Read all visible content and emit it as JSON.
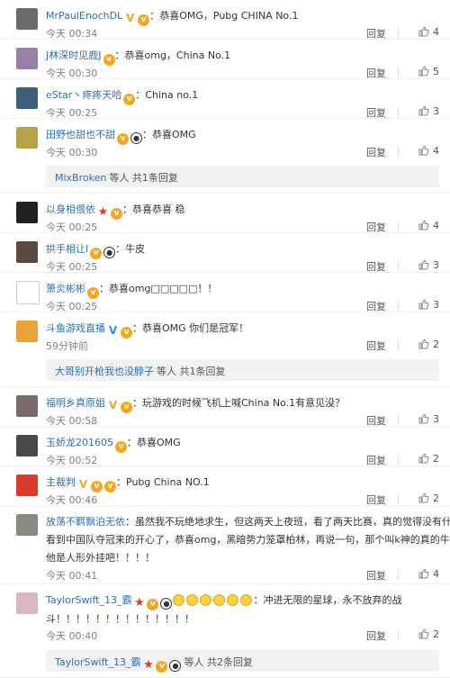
{
  "comments": [
    {
      "user": "MrPaulEnochDL",
      "badges": [
        "vbadge",
        "vip"
      ],
      "sep": "：",
      "text": "恭喜OMG，Pubg CHINA No.1",
      "time": "今天 00:34",
      "reply": "回复",
      "likes": "4",
      "avatar_color": "#6a6a6a"
    },
    {
      "user": "J林深时见鹿J",
      "badges": [
        "vip"
      ],
      "sep": "：",
      "text": "恭喜omg，China No.1",
      "time": "今天 00:30",
      "reply": "回复",
      "likes": "5",
      "avatar_color": "#9a7fa6"
    },
    {
      "user": "eStar丶疼疼天哈",
      "badges": [
        "vip"
      ],
      "sep": "：",
      "text": "China no.1",
      "time": "今天 00:25",
      "reply": "回复",
      "likes": "3",
      "avatar_color": "#3d5f7a"
    },
    {
      "user": "田野也甜也不甜",
      "badges": [
        "vip",
        "panda"
      ],
      "sep": "：",
      "text": "恭喜OMG",
      "time": "今天 00:30",
      "reply": "回复",
      "likes": "4",
      "avatar_color": "#b8a24a"
    },
    {
      "user": "以身相偎依",
      "badges": [
        "star",
        "vip"
      ],
      "sep": "：",
      "text": "恭喜恭喜 稳",
      "time": "今天 00:25",
      "reply": "回复",
      "likes": "4",
      "avatar_color": "#222222"
    },
    {
      "user": "拱手相让l",
      "badges": [
        "vip",
        "panda"
      ],
      "sep": "：",
      "text": "牛皮",
      "time": "今天 00:25",
      "reply": "回复",
      "likes": "3",
      "avatar_color": "#5b4a3f"
    },
    {
      "user": "箫炎彬彬",
      "badges": [
        "vip"
      ],
      "sep": "：",
      "text": "恭喜omg□□□□□！！",
      "time": "今天 00:25",
      "reply": "回复",
      "likes": "3",
      "avatar_color": "#ffffff"
    },
    {
      "user": "斗鱼游戏直播",
      "badges": [
        "vbadge-blue",
        "vip"
      ],
      "sep": "：",
      "text": "恭喜OMG 你们是冠军！",
      "time": "59分钟前",
      "reply": "回复",
      "likes": "2",
      "avatar_color": "#e8a33b"
    },
    {
      "user": "福明乡真原姐",
      "badges": [
        "vbadge",
        "vip"
      ],
      "sep": "：",
      "text": "玩游戏的时候飞机上喊China No.1有意见没？",
      "time": "今天 00:58",
      "reply": "回复",
      "likes": "3",
      "avatar_color": "#7a6a6a"
    },
    {
      "user": "玉娇龙201605",
      "badges": [
        "vip"
      ],
      "sep": "：",
      "text": "恭喜OMG",
      "time": "今天 00:52",
      "reply": "回复",
      "likes": "2",
      "avatar_color": "#4a4a4a"
    },
    {
      "user": "主裁判",
      "badges": [
        "vbadge",
        "vip",
        "vip"
      ],
      "sep": "：",
      "text": "Pubg China NO.1",
      "time": "今天 00:46",
      "reply": "回复",
      "likes": "2",
      "avatar_color": "#d93a2b"
    },
    {
      "user": "放荡不羁飘泊无依",
      "sep": "：",
      "lines": [
        "虽然我不玩绝地求生，但这两天上夜班，看了两天比赛，真的觉得没有什么比",
        "看到中国队夺冠来的开心了，恭喜omg，黑暗势力笼罩柏林，再说一句，那个叫k神的真的牛皮，",
        "他是人形外挂吧！！！！"
      ],
      "time": "今天 00:41",
      "reply": "回复",
      "likes": "4",
      "avatar_color": "#8a8a80"
    },
    {
      "user": "TaylorSwift_13_霸",
      "badges": [
        "star",
        "vip",
        "panda"
      ],
      "sep": "：",
      "emoji_count": 6,
      "lines": [
        "冲进无限的星球，永不放弃的战",
        "斗！！！！！！！！！！！！！！"
      ],
      "time": "今天 00:40",
      "reply": "回复",
      "likes": "2",
      "avatar_color": "#d9b7c2"
    }
  ],
  "reply_threads": [
    {
      "after": 3,
      "user": "MixBroken",
      "badges": [],
      "rest": "等人 共1条回复"
    },
    {
      "after": 7,
      "user": "大哥别开枪我也没脖子",
      "badges": [],
      "rest": "等人 共1条回复"
    },
    {
      "after": 12,
      "user": "TaylorSwift_13_霸",
      "badges": [
        "star",
        "vip",
        "panda"
      ],
      "rest": "等人 共2条回复"
    }
  ],
  "colors": {
    "username": "#2e6fb2",
    "meta": "#808080",
    "vip_badge": "#f5a623",
    "verified_blue": "#2e8ae6",
    "star": "#e03b23",
    "reply_bg": "#f2f2f5"
  },
  "icons": {
    "like": "thumbs-up-icon",
    "vip": "vip-badge-icon",
    "verified": "verified-v-icon",
    "panda": "panda-badge-icon",
    "star": "star-badge-icon"
  }
}
